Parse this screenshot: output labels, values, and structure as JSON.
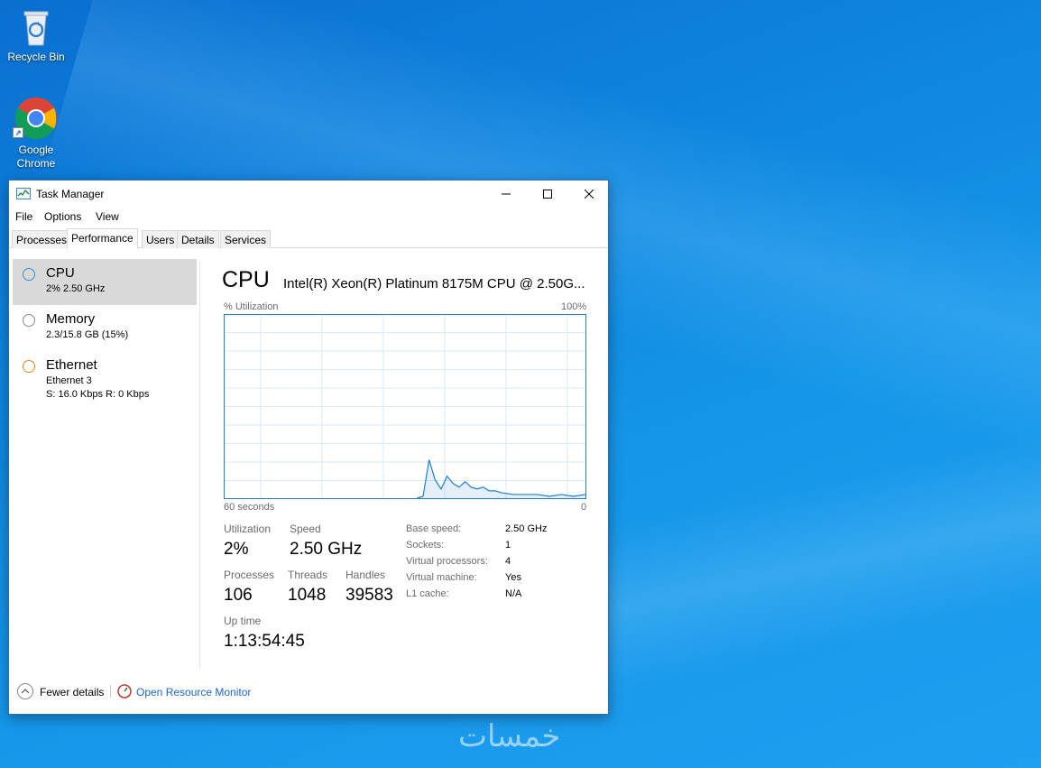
{
  "desktop": {
    "icons": [
      {
        "label": "Recycle Bin",
        "icon": "recycle-bin-icon"
      },
      {
        "label_line1": "Google",
        "label_line2": "Chrome",
        "icon": "chrome-icon"
      }
    ],
    "watermark": "خمسات"
  },
  "window": {
    "title": "Task Manager",
    "menu": [
      "File",
      "Options",
      "View"
    ],
    "tabs": [
      "Processes",
      "Performance",
      "Users",
      "Details",
      "Services"
    ],
    "active_tab": "Performance"
  },
  "sidebar": {
    "items": [
      {
        "name": "CPU",
        "sub1": "2% 2.50 GHz",
        "selected": true,
        "ring_color": "#3a8dd8"
      },
      {
        "name": "Memory",
        "sub1": "2.3/15.8 GB (15%)",
        "selected": false,
        "ring_color": "#8a8a8a"
      },
      {
        "name": "Ethernet",
        "sub1": "Ethernet 3",
        "sub2": "S: 16.0 Kbps  R: 0 Kbps",
        "selected": false,
        "ring_color": "#d08b2a"
      }
    ]
  },
  "main": {
    "title": "CPU",
    "model": "Intel(R) Xeon(R) Platinum 8175M CPU @ 2.50G...",
    "graph": {
      "y_label": "% Utilization",
      "y_max_label": "100%",
      "x_left_label": "60 seconds",
      "x_right_label": "0",
      "line_color": "#1f7fd8",
      "grid_color": "#d9eaf7"
    },
    "stats": {
      "utilization_label": "Utilization",
      "utilization": "2%",
      "speed_label": "Speed",
      "speed": "2.50 GHz",
      "processes_label": "Processes",
      "processes": "106",
      "threads_label": "Threads",
      "threads": "1048",
      "handles_label": "Handles",
      "handles": "39583",
      "uptime_label": "Up time",
      "uptime": "1:13:54:45"
    },
    "specs": [
      {
        "k": "Base speed:",
        "v": "2.50 GHz"
      },
      {
        "k": "Sockets:",
        "v": "1"
      },
      {
        "k": "Virtual processors:",
        "v": "4"
      },
      {
        "k": "Virtual machine:",
        "v": "Yes"
      },
      {
        "k": "L1 cache:",
        "v": "N/A"
      }
    ]
  },
  "footer": {
    "fewer_details": "Fewer details",
    "open_resource_monitor": "Open Resource Monitor"
  },
  "chart_data": {
    "type": "area",
    "x": [
      60,
      58,
      56,
      54,
      52,
      50,
      48,
      46,
      44,
      42,
      40,
      38,
      36,
      34,
      32,
      30,
      28,
      27,
      26,
      25,
      24,
      23,
      22,
      21,
      20,
      19,
      18,
      17,
      16,
      15,
      14,
      12,
      10,
      8,
      6,
      4,
      2,
      0
    ],
    "values": [
      0,
      0,
      0,
      0,
      0,
      0,
      0,
      0,
      0,
      0,
      0,
      0,
      0,
      0,
      0,
      0,
      0,
      1,
      21,
      10,
      5,
      12,
      8,
      6,
      9,
      6,
      5,
      6,
      4,
      4,
      3,
      2,
      2,
      2,
      1,
      2,
      1,
      2
    ],
    "ylim": [
      0,
      100
    ],
    "xlim": [
      60,
      0
    ],
    "grid": true
  }
}
